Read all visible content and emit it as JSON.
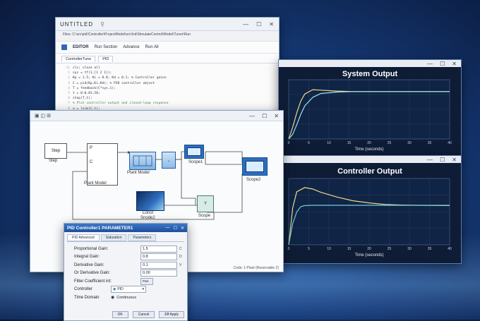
{
  "editor": {
    "title": "UNTITLED",
    "path": "Files: C:\\src\\pid\\Controller\\ProjectModel\\src\\Init\\SimulateControl\\Model\\Tuner\\Run",
    "toolbar": [
      "EDITOR",
      "Run Section",
      "Advance",
      "Run All"
    ],
    "tab": "ControllerTune",
    "tab2": "PID",
    "code": [
      {
        "n": "11",
        "t": "clc; close all"
      },
      {
        "n": "1",
        "t": "sys = tf(1,[1 2 1]);"
      },
      {
        "n": "2",
        "t": "Kp = 1.5; Ki = 0.8; Kd = 0.1;  % Controller gains"
      },
      {
        "n": "3",
        "t": "C = pid(Kp,Ki,Kd);  % PID controller object"
      },
      {
        "n": "4",
        "t": "T = feedback(C*sys,1);"
      },
      {
        "n": "5",
        "t": "t = 0:0.01:20;"
      },
      {
        "n": "6",
        "t": "step(T,t);"
      },
      {
        "n": "7",
        "t": "% Plot controller output and closed-loop response"
      },
      {
        "n": "8",
        "t": "u = lsim(C,t);"
      },
      {
        "n": "9",
        "t": "% Design controller for Plant, with tuning"
      },
      {
        "n": "10",
        "t": "plot(t,u);"
      }
    ]
  },
  "system_plot": {
    "title": "System Output",
    "xlabel": "Time (seconds)"
  },
  "controller_plot": {
    "title": "Controller Output",
    "xlabel": "Time (seconds)"
  },
  "model": {
    "blocks": {
      "step": "Step",
      "step_label": "Step",
      "plant_label": "Plant Model",
      "plant_p": "P",
      "plant_c": "C",
      "plant2_label": "Plant Model",
      "scope1_label": "Scope1",
      "scope2_label": "Scope2",
      "const_label": "Const\nSnode2",
      "scope_y": "Y",
      "scope_label": "Scope"
    },
    "status": "Code: 1 Plant (Reservable 2)"
  },
  "pid_dialog": {
    "title": "PID Controller1 PARAMETER1",
    "tabs": [
      "PID Advanced",
      "Saturation",
      "Parameters"
    ],
    "fields": [
      {
        "label": "Proportional Gain:",
        "value": "1.5",
        "unit": "C"
      },
      {
        "label": "Integral Gain:",
        "value": "0.8",
        "unit": "D"
      },
      {
        "label": "Derivative Gain:",
        "value": "0.1",
        "unit": "V"
      },
      {
        "label": "Or Derivative Gain:",
        "value": "0.00",
        "unit": ""
      },
      {
        "label": "Filter Coefficient int:",
        "value": "Part",
        "unit": ""
      }
    ],
    "controller_label": "Controller",
    "controller_value": "PID",
    "domain_label": "Time Domain",
    "domain_value": "Continuous",
    "buttons": [
      "OK",
      "Cancel",
      "Eff Apply"
    ]
  },
  "chart_data": [
    {
      "type": "line",
      "title": "System Output",
      "xlabel": "Time (seconds)",
      "ylabel": "",
      "xlim": [
        0,
        20
      ],
      "x_ticks": [
        0,
        5,
        10,
        15,
        20,
        25,
        30,
        35,
        40
      ],
      "series": [
        {
          "color": "#f1d88a",
          "x": [
            0,
            0.5,
            1,
            1.5,
            2,
            3,
            4,
            6,
            8,
            12,
            20
          ],
          "y": [
            0,
            0.25,
            0.55,
            0.8,
            0.95,
            1.04,
            1.03,
            1.01,
            1.0,
            1.0,
            1.0
          ]
        },
        {
          "color": "#9fe3ec",
          "x": [
            0,
            0.5,
            1,
            1.5,
            2,
            3,
            4,
            6,
            8,
            12,
            20
          ],
          "y": [
            0,
            0.1,
            0.3,
            0.52,
            0.7,
            0.88,
            0.96,
            0.99,
            1.0,
            1.0,
            1.0
          ]
        }
      ]
    },
    {
      "type": "line",
      "title": "Controller Output",
      "xlabel": "Time (seconds)",
      "ylabel": "",
      "xlim": [
        0,
        20
      ],
      "x_ticks": [
        0,
        5,
        10,
        15,
        20,
        25,
        30,
        35,
        40
      ],
      "series": [
        {
          "color": "#f1d88a",
          "x": [
            0,
            0.5,
            1,
            2,
            3,
            4,
            6,
            8,
            10,
            12,
            14,
            16,
            20
          ],
          "y": [
            0,
            0.7,
            1.0,
            1.08,
            1.05,
            0.99,
            0.9,
            0.83,
            0.79,
            0.76,
            0.75,
            0.745,
            0.74
          ]
        },
        {
          "color": "#6fcad6",
          "x": [
            0,
            0.5,
            1,
            1.5,
            2,
            3,
            5,
            8,
            12,
            20
          ],
          "y": [
            0,
            0.4,
            0.62,
            0.72,
            0.74,
            0.745,
            0.745,
            0.745,
            0.745,
            0.745
          ]
        }
      ]
    }
  ]
}
